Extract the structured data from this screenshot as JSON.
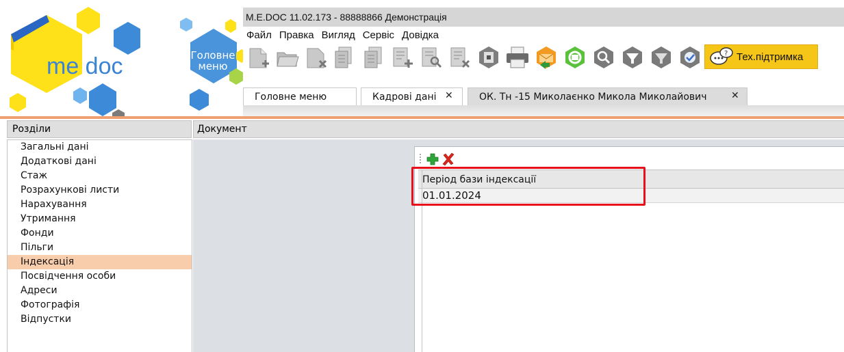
{
  "app": {
    "title": "M.E.DOC 11.02.173  - 88888866 Демонстрація",
    "logo_text": "me doc",
    "home_button": {
      "line1": "Головне",
      "line2": "меню"
    }
  },
  "menu": [
    "Файл",
    "Правка",
    "Вигляд",
    "Сервіс",
    "Довідка"
  ],
  "toolbar": {
    "icons": [
      "new-doc-icon",
      "open-doc-icon",
      "delete-doc-icon",
      "copy-doc-icon",
      "copy-doc-icon",
      "add-doc-icon",
      "search-doc-icon",
      "remove-doc-icon",
      "archive-icon",
      "print-icon",
      "send-mail-icon",
      "mail-sync-icon",
      "find-icon",
      "filter-icon",
      "filter-clear-icon",
      "signature-check-icon"
    ],
    "support_label": "Тех.підтримка"
  },
  "tabs": [
    {
      "label": "Головне меню",
      "closable": false,
      "active": false
    },
    {
      "label": "Кадрові дані",
      "closable": true,
      "active": false
    },
    {
      "label": "ОК. Тн -15 Миколаєнко Микола Миколайович",
      "closable": true,
      "active": true
    }
  ],
  "tab_close_glyph": "✕",
  "sections": {
    "header": "Розділи",
    "items": [
      "Загальні дані",
      "Додаткові дані",
      "Стаж",
      "Розрахункові листи",
      "Нарахування",
      "Утримання",
      "Фонди",
      "Пільги",
      "Індексація",
      "Посвідчення особи",
      "Адреси",
      "Фотографія",
      "Відпустки"
    ],
    "selected_index": 8
  },
  "document": {
    "header": "Документ",
    "grid": {
      "columns": [
        "Період бази індексації"
      ],
      "rows": [
        [
          "01.01.2024"
        ]
      ],
      "highlighted": true
    }
  },
  "colors": {
    "accent_orange": "#f0a070",
    "selected_row": "#f8cdab",
    "support_button": "#f5c518",
    "highlight_border": "#e8101a",
    "logo_yellow": "#ffe11a",
    "logo_blue": "#3d8bd8"
  }
}
